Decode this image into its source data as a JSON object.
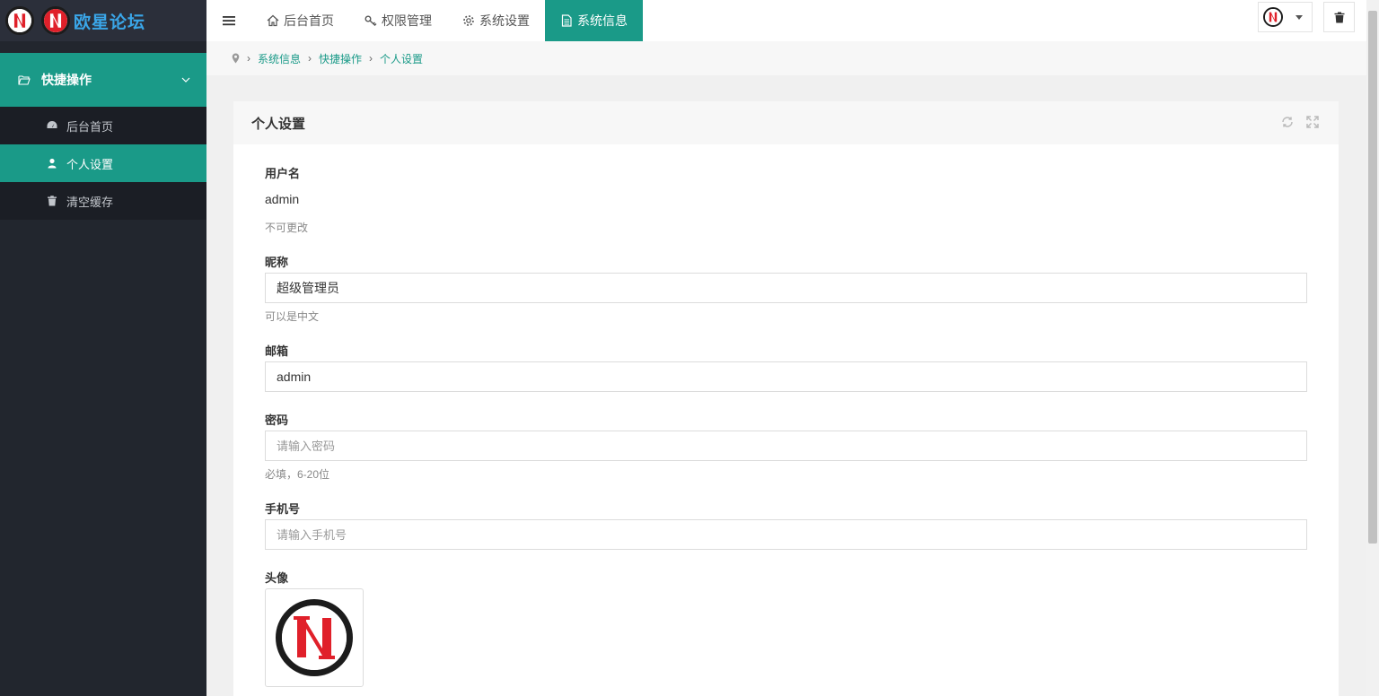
{
  "brand": {
    "name": "欧星论坛"
  },
  "sidebar": {
    "group": {
      "label": "快捷操作",
      "icon": "folder-open-icon"
    },
    "items": [
      {
        "label": "后台首页",
        "icon": "dashboard-icon",
        "active": false
      },
      {
        "label": "个人设置",
        "icon": "user-icon",
        "active": true
      },
      {
        "label": "清空缓存",
        "icon": "trash-icon",
        "active": false
      }
    ]
  },
  "topnav": {
    "items": [
      {
        "label": "后台首页",
        "icon": "home-icon"
      },
      {
        "label": "权限管理",
        "icon": "key-icon"
      },
      {
        "label": "系统设置",
        "icon": "gear-icon"
      },
      {
        "label": "系统信息",
        "icon": "document-icon",
        "active": true
      }
    ]
  },
  "breadcrumb": {
    "items": [
      "系统信息",
      "快捷操作",
      "个人设置"
    ]
  },
  "panel": {
    "title": "个人设置",
    "fields": {
      "username": {
        "label": "用户名",
        "value": "admin",
        "help": "不可更改"
      },
      "nickname": {
        "label": "昵称",
        "value": "超级管理员",
        "help": "可以是中文"
      },
      "email": {
        "label": "邮箱",
        "value": "admin"
      },
      "password": {
        "label": "密码",
        "placeholder": "请输入密码",
        "help": "必填，6-20位"
      },
      "phone": {
        "label": "手机号",
        "placeholder": "请输入手机号"
      },
      "avatar": {
        "label": "头像"
      }
    }
  },
  "colors": {
    "accent": "#1a9a88",
    "sidebar_bg": "#22262e",
    "logo_red": "#e0202a",
    "logo_text": "#3aa6e8"
  }
}
